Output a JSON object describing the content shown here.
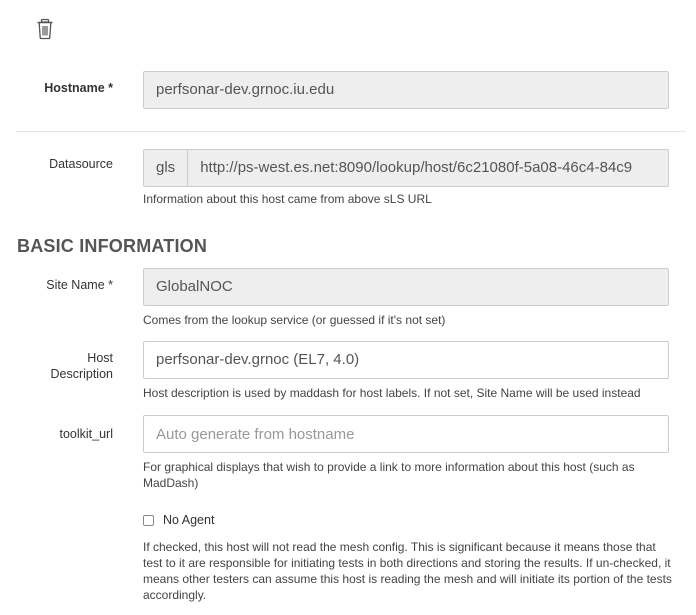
{
  "toolbar": {
    "delete_icon": "trash-icon"
  },
  "hostname": {
    "label": "Hostname *",
    "value": "perfsonar-dev.grnoc.iu.edu"
  },
  "datasource": {
    "label": "Datasource",
    "prefix": "gls",
    "value": "http://ps-west.es.net:8090/lookup/host/6c21080f-5a08-46c4-84c9",
    "help": "Information about this host came from above sLS URL"
  },
  "basic_information": {
    "title": "BASIC INFORMATION",
    "site_name": {
      "label": "Site Name *",
      "value": "GlobalNOC",
      "help": "Comes from the lookup service (or guessed if it's not set)"
    },
    "host_description": {
      "label_line1": "Host",
      "label_line2": "Description",
      "value": "perfsonar-dev.grnoc (EL7, 4.0)",
      "help": "Host description is used by maddash for host labels. If not set, Site Name will be used instead"
    },
    "toolkit_url": {
      "label": "toolkit_url",
      "value": "",
      "placeholder": "Auto generate from hostname",
      "help": "For graphical displays that wish to provide a link to more information about this host (such as MadDash)"
    },
    "no_agent": {
      "label": "No Agent",
      "checked": false,
      "help": "If checked, this host will not read the mesh config. This is significant because it means those that test to it are responsible for initiating tests in both directions and storing the results. If un-checked, it means other testers can assume this host is reading the mesh and will initiate its portion of the tests accordingly."
    }
  }
}
